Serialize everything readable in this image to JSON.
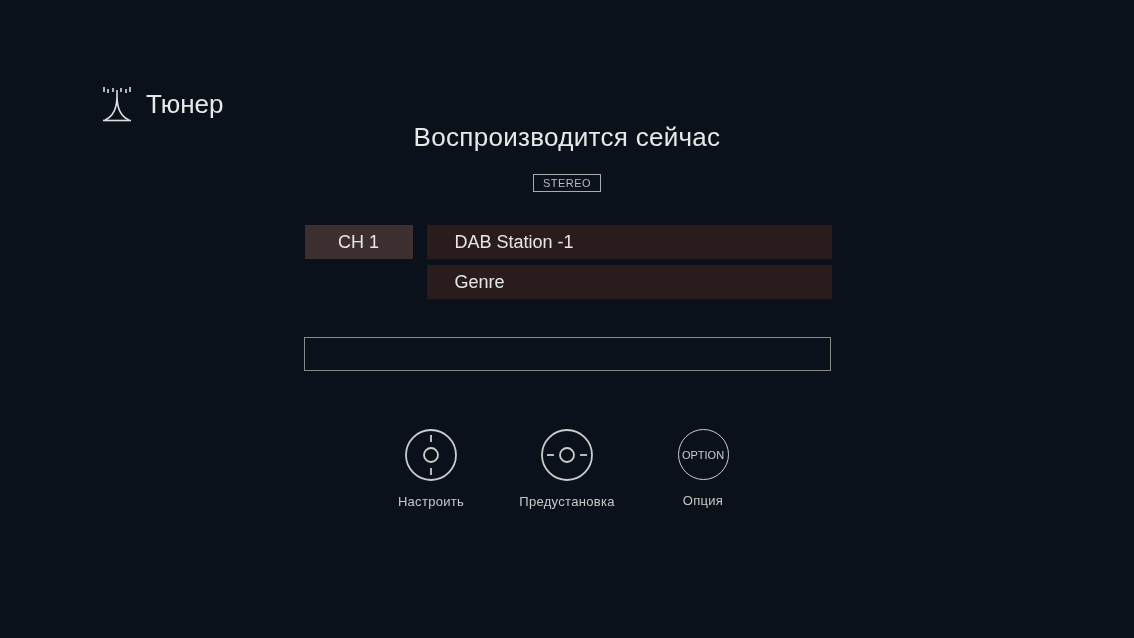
{
  "header": {
    "title": "Тюнер"
  },
  "now_playing": {
    "title": "Воспроизводится сейчас",
    "badge": "STEREO"
  },
  "station": {
    "channel": "CH 1",
    "name": "DAB Station -1",
    "genre": "Genre"
  },
  "controls": [
    {
      "kind": "tune",
      "label": "Настроить"
    },
    {
      "kind": "preset",
      "label": "Предустановка"
    },
    {
      "kind": "option",
      "icon_text": "OPTION",
      "label": "Опция"
    }
  ]
}
